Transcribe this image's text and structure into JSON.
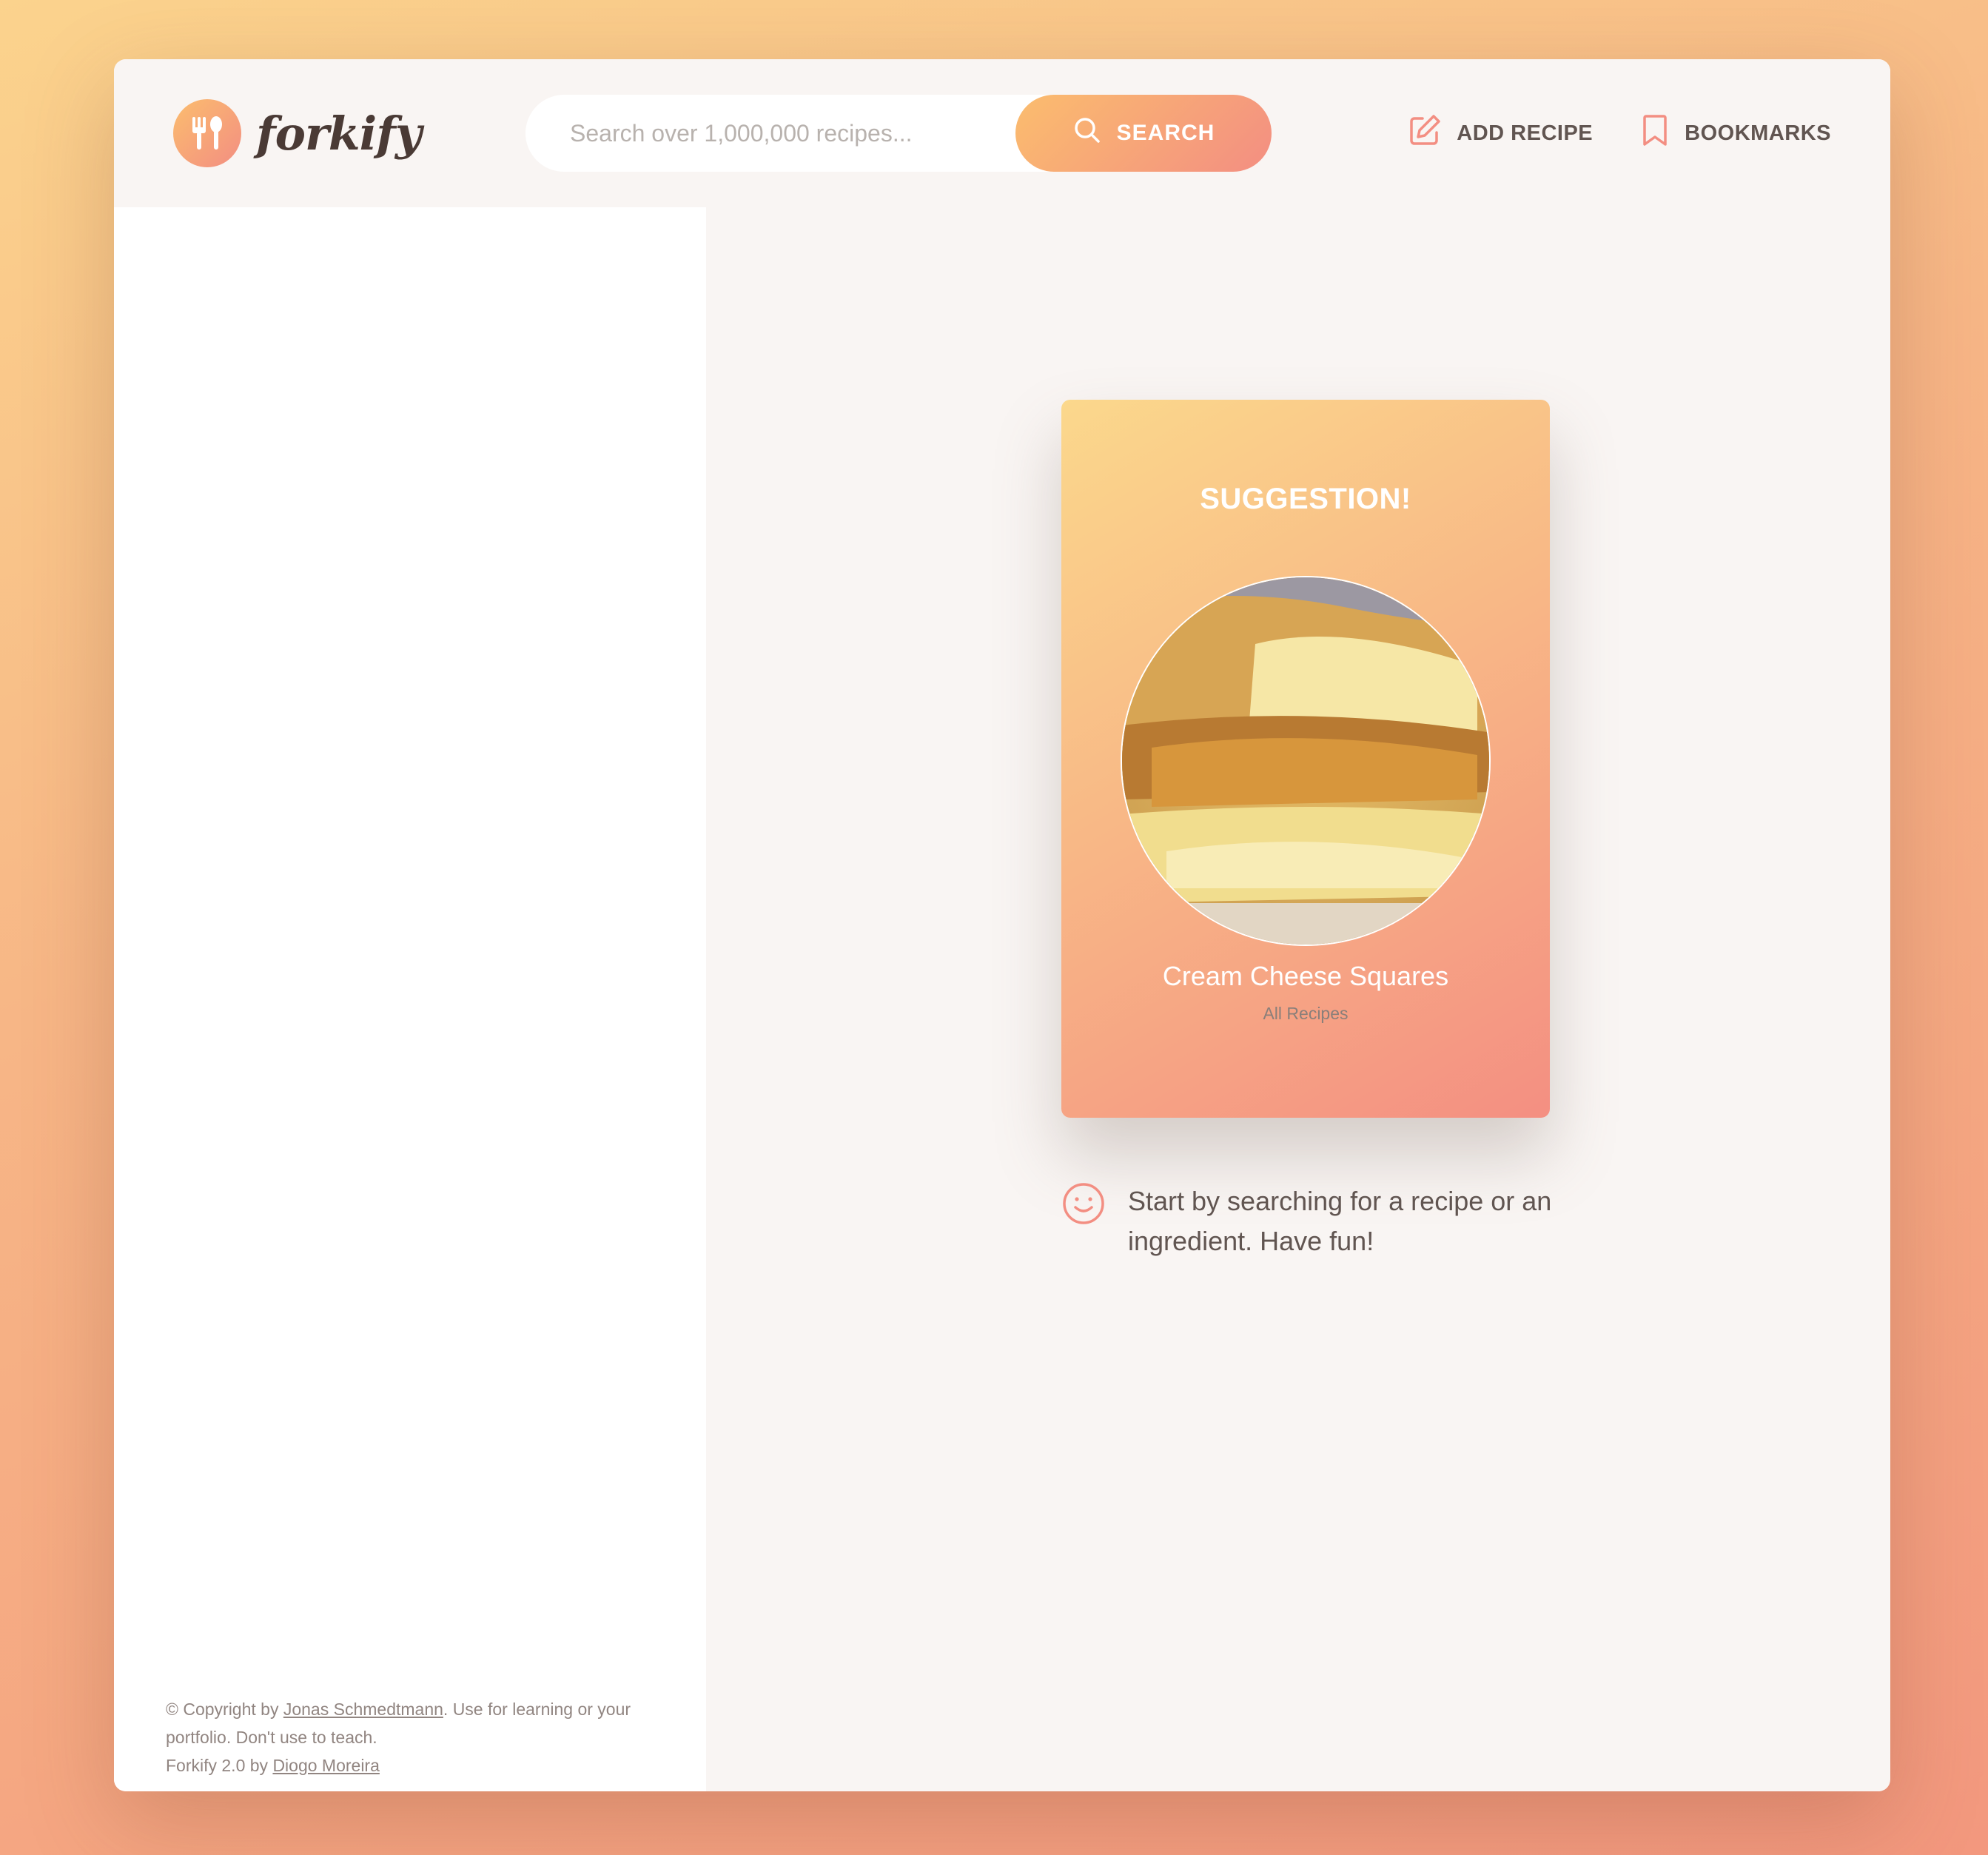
{
  "header": {
    "logo_text": "forkify",
    "search": {
      "placeholder": "Search over 1,000,000 recipes...",
      "button_label": "SEARCH"
    },
    "nav": {
      "add_recipe": "ADD RECIPE",
      "bookmarks": "BOOKMARKS"
    }
  },
  "sidebar": {
    "copyright": {
      "prefix": "© Copyright by ",
      "author": "Jonas Schmedtmann",
      "suffix": ". Use for learning or your portfolio. Don't use to teach.",
      "version_prefix": "Forkify 2.0 by ",
      "version_author": "Diogo Moreira"
    }
  },
  "suggestion": {
    "title": "SUGGESTION!",
    "recipe_name": "Cream Cheese Squares",
    "source": "All Recipes"
  },
  "message": {
    "text": "Start by searching for a recipe or an ingredient. Have fun!"
  },
  "colors": {
    "accent_start": "#fbbd6e",
    "accent_end": "#f38e82",
    "text_dark": "#615551"
  }
}
